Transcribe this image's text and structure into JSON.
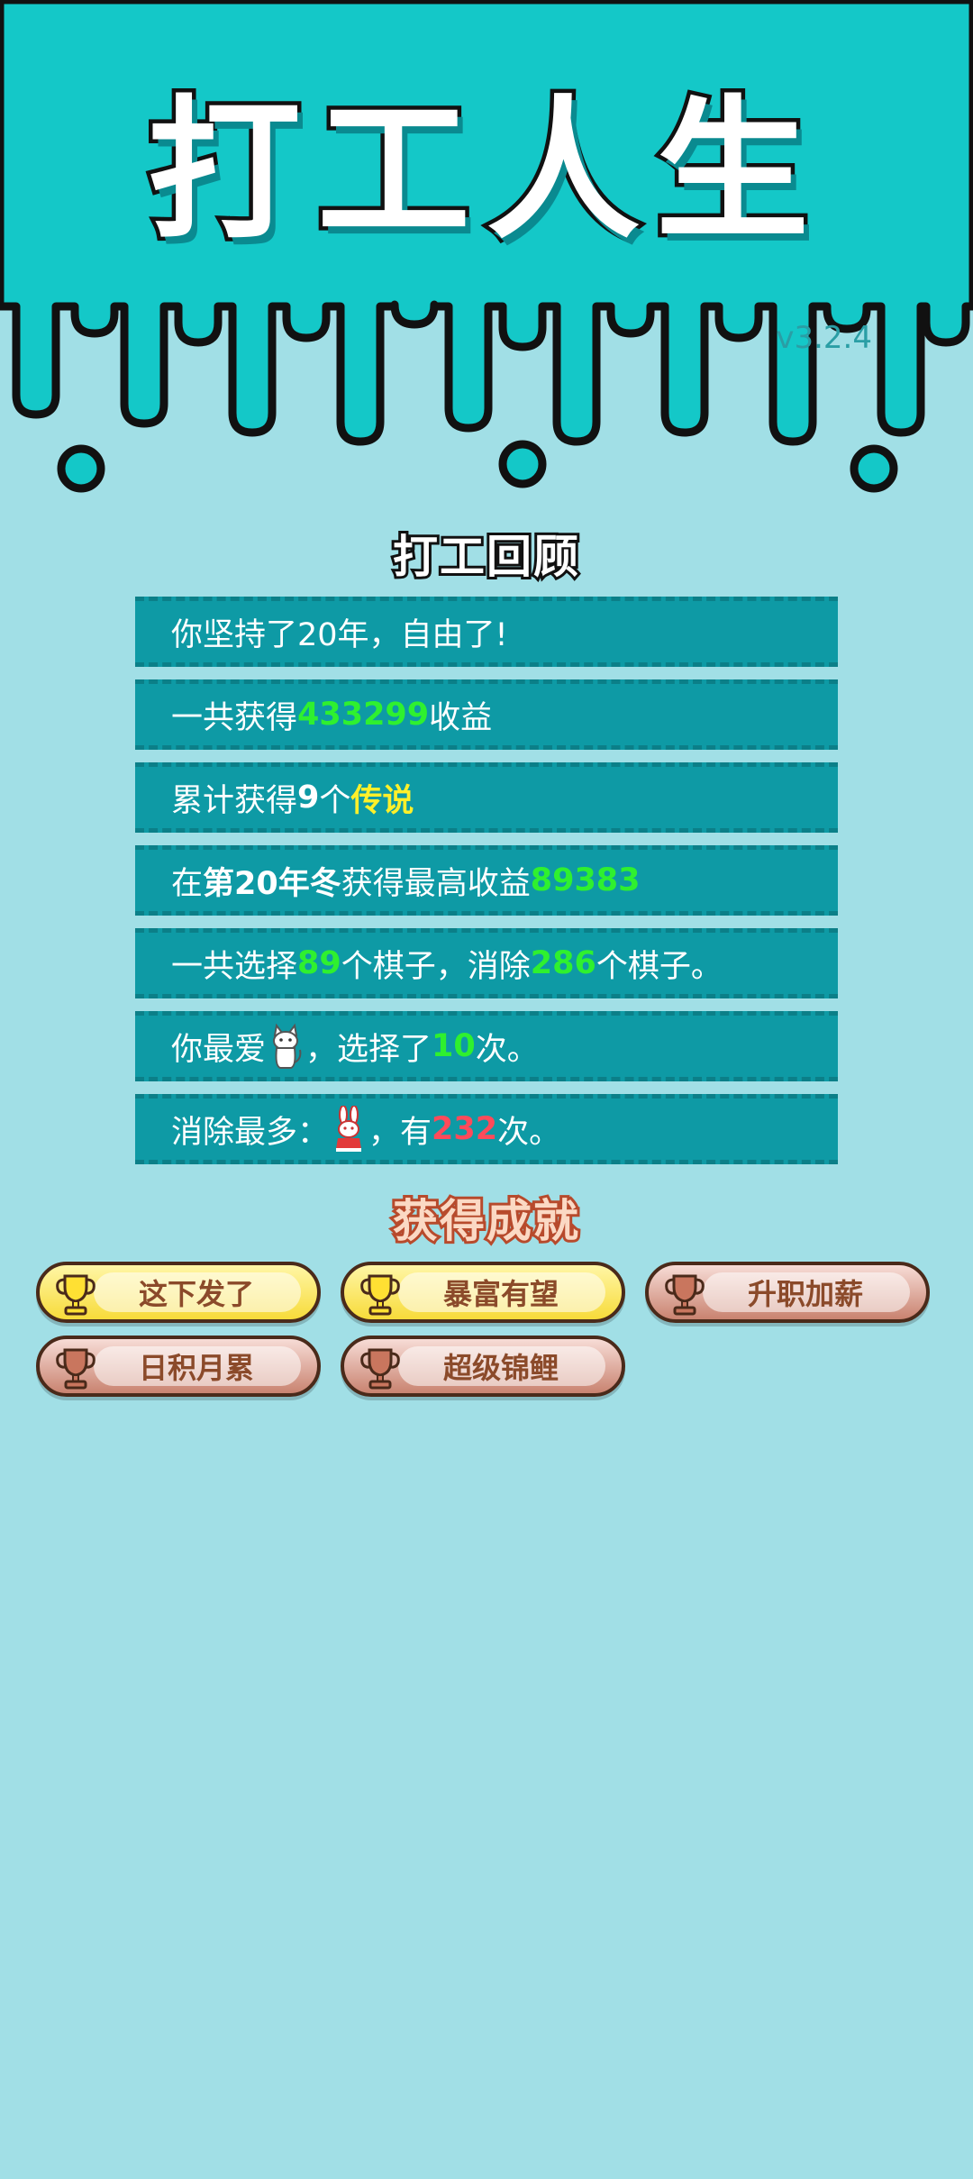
{
  "app": {
    "title": "打工人生",
    "version": "v3.2.4"
  },
  "review": {
    "title": "打工回顾",
    "rows": {
      "r1": {
        "text": "你坚持了20年，自由了!"
      },
      "r2": {
        "pre": "一共获得",
        "value": "433299",
        "post": "收益"
      },
      "r3": {
        "pre": "累计获得",
        "count": "9",
        "mid": "个",
        "value": "传说"
      },
      "r4": {
        "pre": "在 ",
        "season": "第20年冬",
        "mid": " 获得最高收益",
        "value": "89383"
      },
      "r5": {
        "pre": "一共选择",
        "v1": "89",
        "mid": "个棋子，消除",
        "v2": "286",
        "post": "个棋子。"
      },
      "r6": {
        "pre": "你最爱",
        "mid": "，选择了",
        "value": "10",
        "post": "次。",
        "icon": "cat-icon"
      },
      "r7": {
        "pre": "消除最多：",
        "mid": "，有",
        "value": "232",
        "post": "次。",
        "icon": "rabbit-icon"
      }
    }
  },
  "achievements": {
    "title": "获得成就",
    "items": [
      {
        "label": "这下发了",
        "tier": "gold"
      },
      {
        "label": "暴富有望",
        "tier": "gold"
      },
      {
        "label": "升职加薪",
        "tier": "bronze"
      },
      {
        "label": "日积月累",
        "tier": "bronze"
      },
      {
        "label": "超级锦鲤",
        "tier": "bronze"
      }
    ]
  },
  "colors": {
    "header": "#14c8c8",
    "background": "#a1dfe6",
    "row": "#0e9aa5",
    "highlight_green": "#2ff02f",
    "highlight_yellow": "#fff02a",
    "highlight_red": "#ff4a5a"
  }
}
